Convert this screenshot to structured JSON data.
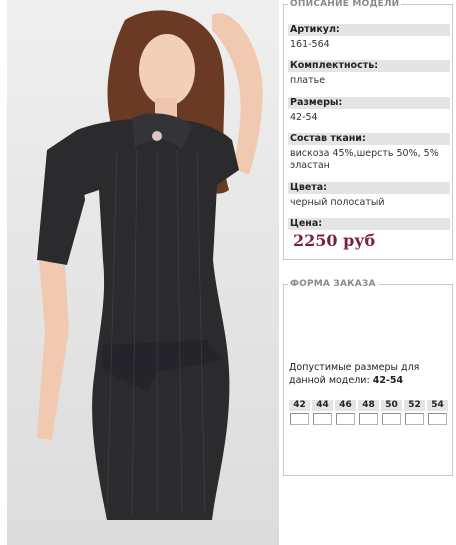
{
  "description": {
    "title": "ОПИСАНИЕ МОДЕЛИ",
    "attributes": [
      {
        "label": "Артикул:",
        "value": "161-564"
      },
      {
        "label": "Комплектность:",
        "value": "платье"
      },
      {
        "label": "Размеры:",
        "value": "42-54"
      },
      {
        "label": "Состав ткани:",
        "value": "вискоза 45%,шерсть 50%, 5% эластан"
      },
      {
        "label": "Цвета:",
        "value": "черный полосатый"
      }
    ],
    "price_label": "Цена:",
    "price_value": "2250 руб"
  },
  "order_form": {
    "title": "ФОРМА ЗАКАЗА",
    "sizes_text": "Допустимые размеры для данной модели:",
    "sizes_range": "42-54",
    "sizes": [
      "42",
      "44",
      "46",
      "48",
      "50",
      "52",
      "54"
    ]
  },
  "colors": {
    "price": "#7a1f3d",
    "label_bg": "#e4e4e4",
    "border": "#c9c9c9"
  }
}
